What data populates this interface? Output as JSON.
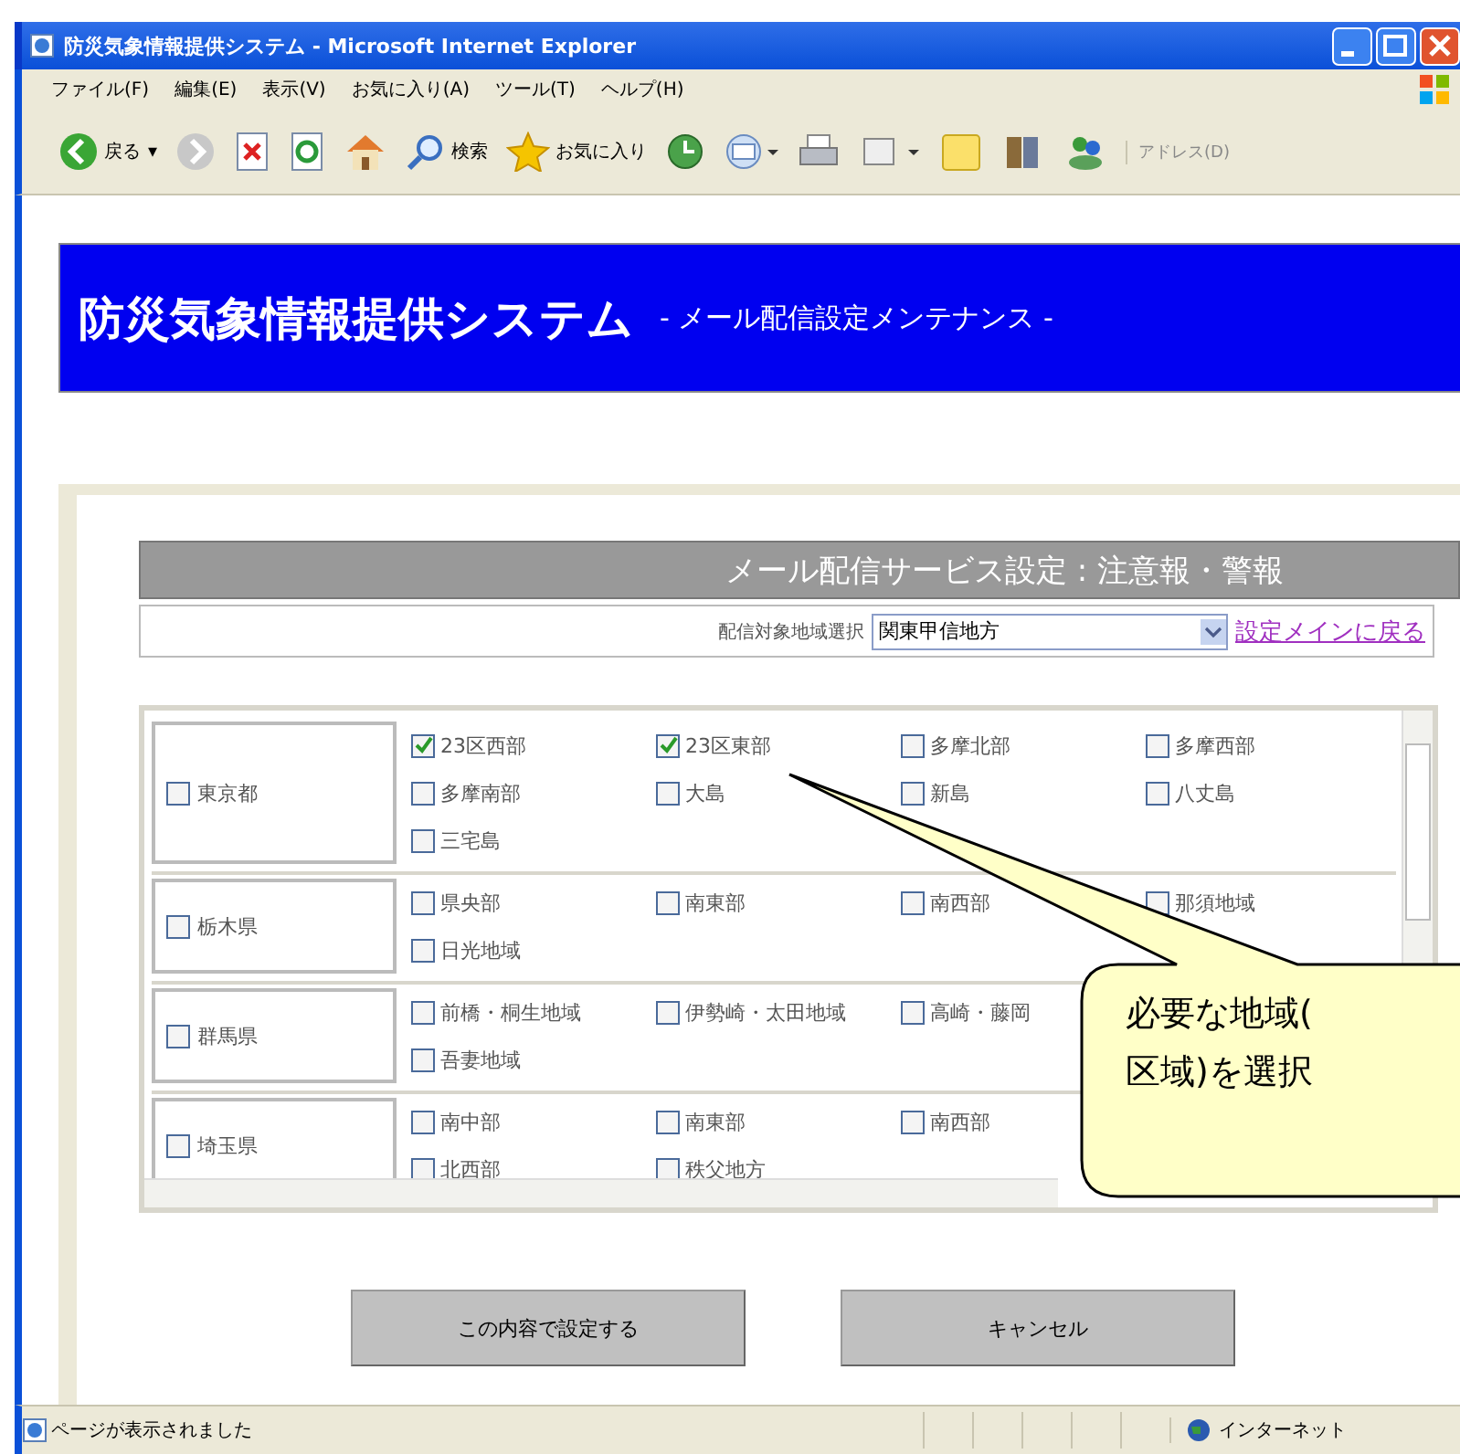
{
  "window": {
    "title": "防災気象情報提供システム - Microsoft Internet Explorer"
  },
  "menu": [
    "ファイル(F)",
    "編集(E)",
    "表示(V)",
    "お気に入り(A)",
    "ツール(T)",
    "ヘルプ(H)"
  ],
  "toolbar": {
    "back": "戻る",
    "back_menu": "▾",
    "search": "検索",
    "favorites": "お気に入り",
    "address": "アドレス(D)"
  },
  "header": {
    "title": "防災気象情報提供システム",
    "subtitle": "- メール配信設定メンテナンス -"
  },
  "panel": {
    "title": "メール配信サービス設定 : 注意報・警報",
    "region_label": "配信対象地域選択",
    "region_value": "関東甲信地方",
    "back_link": "設定メインに戻る"
  },
  "prefectures": [
    {
      "name": "東京都",
      "checked": false,
      "lines": [
        {
          "areas": [
            {
              "label": "23区西部",
              "checked": true
            },
            {
              "label": "23区東部",
              "checked": true
            },
            {
              "label": "多摩北部",
              "checked": false
            },
            {
              "label": "多摩西部",
              "checked": false
            }
          ]
        },
        {
          "areas": [
            {
              "label": "多摩南部",
              "checked": false
            },
            {
              "label": "大島",
              "checked": false
            },
            {
              "label": "新島",
              "checked": false
            },
            {
              "label": "八丈島",
              "checked": false
            }
          ]
        },
        {
          "areas": [
            {
              "label": "三宅島",
              "checked": false
            }
          ]
        }
      ]
    },
    {
      "name": "栃木県",
      "checked": false,
      "lines": [
        {
          "areas": [
            {
              "label": "県央部",
              "checked": false
            },
            {
              "label": "南東部",
              "checked": false
            },
            {
              "label": "南西部",
              "checked": false
            },
            {
              "label": "那須地域",
              "checked": false
            }
          ]
        },
        {
          "areas": [
            {
              "label": "日光地域",
              "checked": false
            }
          ]
        }
      ]
    },
    {
      "name": "群馬県",
      "checked": false,
      "lines": [
        {
          "areas": [
            {
              "label": "前橋・桐生地域",
              "checked": false
            },
            {
              "label": "伊勢崎・太田地域",
              "checked": false
            },
            {
              "label": "高崎・藤岡",
              "checked": false
            }
          ]
        },
        {
          "areas": [
            {
              "label": "吾妻地域",
              "checked": false
            }
          ]
        }
      ]
    },
    {
      "name": "埼玉県",
      "checked": false,
      "lines": [
        {
          "areas": [
            {
              "label": "南中部",
              "checked": false
            },
            {
              "label": "南東部",
              "checked": false
            },
            {
              "label": "南西部",
              "checked": false
            }
          ]
        },
        {
          "areas": [
            {
              "label": "北西部",
              "checked": false
            },
            {
              "label": "秩父地方",
              "checked": false
            }
          ]
        }
      ]
    }
  ],
  "buttons": [
    "この内容で設定する",
    "キャンセル"
  ],
  "status": {
    "text": "ページが表示されました",
    "zone": "インターネット"
  },
  "callout": [
    "必要な地域(",
    "区域)を選択"
  ]
}
